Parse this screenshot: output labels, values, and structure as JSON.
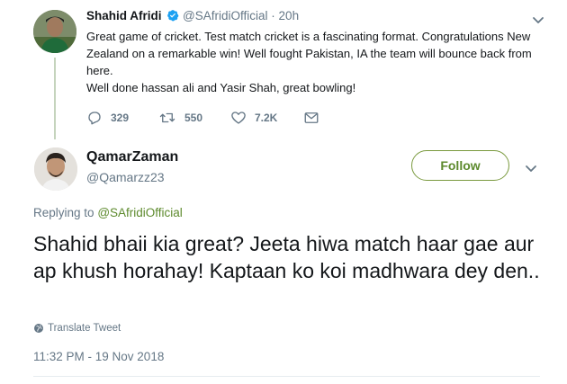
{
  "original_tweet": {
    "author_name": "Shahid Afridi",
    "handle": "@SAfridiOfficial",
    "separator": "·",
    "time": "20h",
    "text_lines": [
      "Great game of cricket. Test match cricket is a fascinating format. Congratulations New Zealand on a remarkable win! Well fought Pakistan, IA the team will bounce back from here.",
      "Well done hassan ali and Yasir Shah, great bowling!"
    ],
    "actions": {
      "replies": "329",
      "retweets": "550",
      "likes": "7.2K"
    },
    "icons": [
      "verified-badge-icon",
      "chevron-down-icon",
      "reply-icon",
      "retweet-icon",
      "like-icon",
      "direct-message-icon"
    ]
  },
  "reply_tweet": {
    "author_name": "QamarZaman",
    "handle": "@Qamarzz23",
    "follow_label": "Follow",
    "replying_prefix": "Replying to",
    "replying_to": "@SAfridiOfficial",
    "text": "Shahid bhaii kia great? Jeeta hiwa match haar gae aur ap khush horahay! Kaptaan ko koi madhwara dey den..",
    "translate_label": "Translate Tweet",
    "timestamp": "11:32 PM - 19 Nov 2018",
    "icons": [
      "globe-icon",
      "chevron-down-icon"
    ]
  },
  "colors": {
    "accent": "#5d8a2d",
    "verified": "#1da1f2",
    "muted_text": "#657786",
    "thread_line": "#c5d4bd"
  }
}
